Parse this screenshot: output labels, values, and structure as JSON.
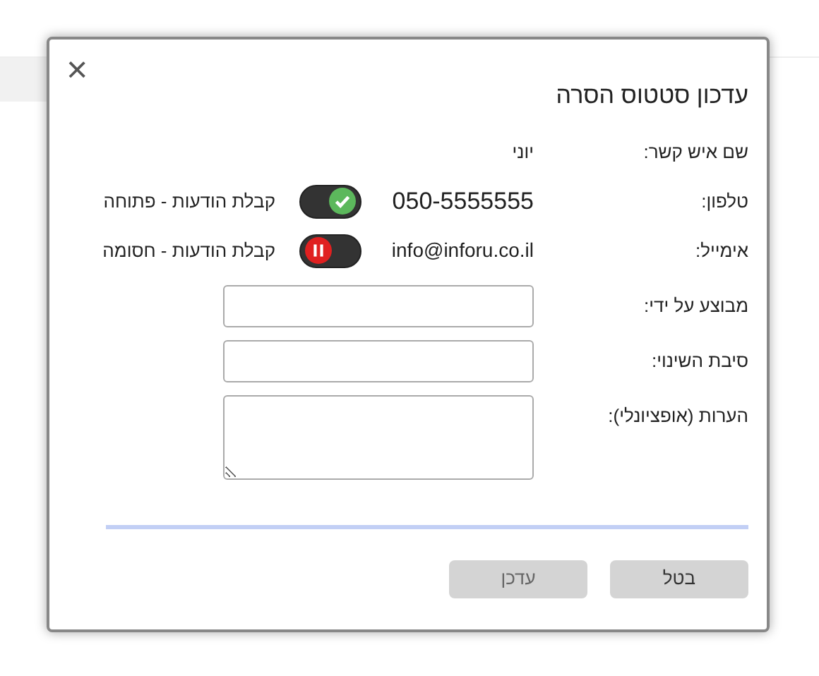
{
  "dialog": {
    "title": "עדכון סטטוס הסרה",
    "close": "×"
  },
  "contact": {
    "label": "שם איש קשר:",
    "value": "יוני"
  },
  "channels": [
    {
      "label": "טלפון:",
      "value": "050-5555555",
      "on": true,
      "status": "קבלת הודעות - פתוחה"
    },
    {
      "label": "אימייל:",
      "value": "info@inforu.co.il",
      "on": false,
      "status": "קבלת הודעות - חסומה"
    }
  ],
  "fields": [
    {
      "label": "מבוצע על ידי:",
      "kind": "input"
    },
    {
      "label": "סיבת השינוי:",
      "kind": "input"
    },
    {
      "label": "הערות (אופציונלי):",
      "kind": "textarea"
    }
  ],
  "buttons": [
    {
      "label": "בטל",
      "disabled": false
    },
    {
      "label": "עדכן",
      "disabled": true
    }
  ]
}
